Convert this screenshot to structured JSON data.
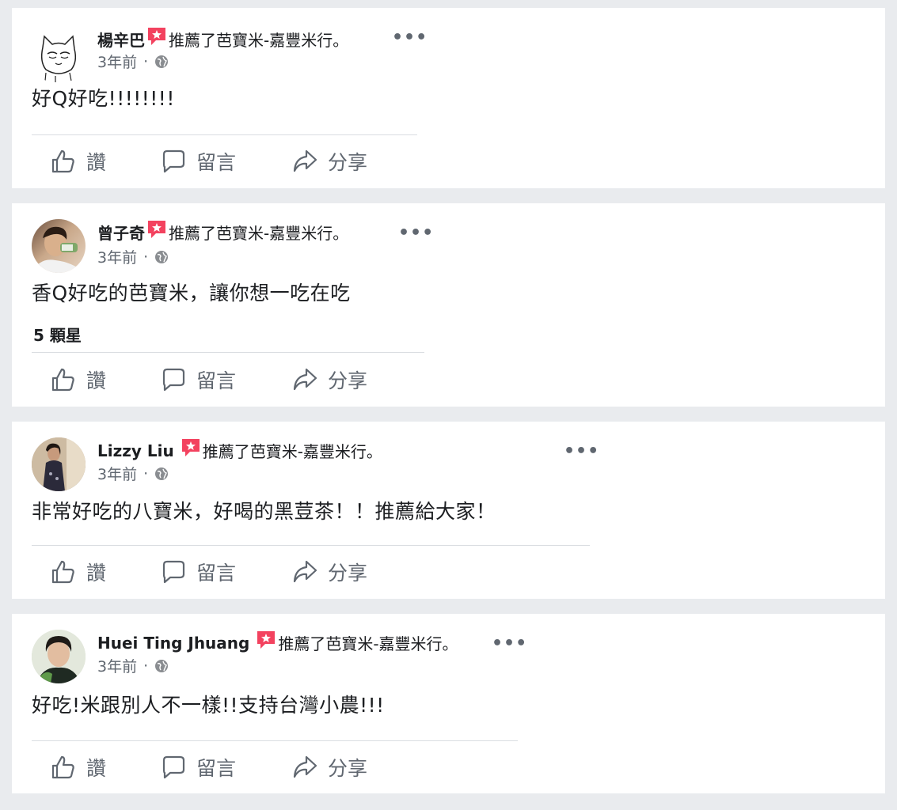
{
  "reviews": [
    {
      "author": "楊辛巴",
      "recommend_text": "推薦了芭寶米-嘉豐米行。",
      "more_label": "•••",
      "time": "3年前",
      "separator": "·",
      "body": "好Q好吃!!!!!!!!",
      "rating": ""
    },
    {
      "author": "曾子奇",
      "recommend_text": "推薦了芭寶米-嘉豐米行。",
      "more_label": "•••",
      "time": "3年前",
      "separator": "·",
      "body": "香Q好吃的芭寶米，讓你想一吃在吃",
      "rating": "5 顆星"
    },
    {
      "author": "Lizzy Liu",
      "recommend_text": "推薦了芭寶米-嘉豐米行。",
      "more_label": "•••",
      "time": "3年前",
      "separator": "·",
      "body": "非常好吃的八寶米，好喝的黑荳茶！！推薦給大家！",
      "rating": ""
    },
    {
      "author": "Huei Ting Jhuang",
      "recommend_text": "推薦了芭寶米-嘉豐米行。",
      "more_label": "•••",
      "time": "3年前",
      "separator": "·",
      "body": "好吃!米跟別人不一樣!!支持台灣小農!!!",
      "rating": ""
    }
  ],
  "actions": {
    "like": "讚",
    "comment": "留言",
    "share": "分享"
  },
  "icons": {
    "recommend": "recommend-badge-icon",
    "privacy": "globe-icon",
    "like": "thumbs-up-icon",
    "comment": "speech-bubble-icon",
    "share": "share-arrow-icon"
  },
  "colors": {
    "badge": "#f3425f",
    "page_bg": "#e9ebee",
    "secondary_text": "#606770"
  }
}
